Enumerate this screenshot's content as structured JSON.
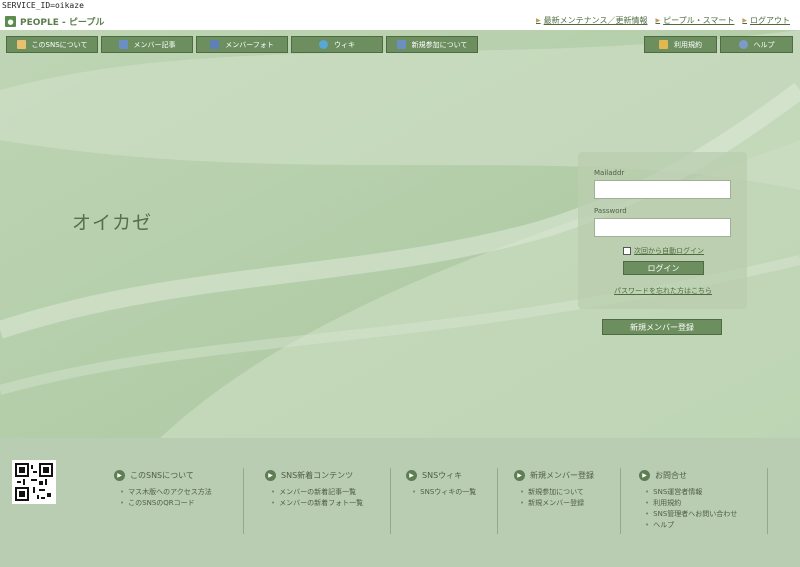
{
  "service_id": "SERVICE_ID=oikaze",
  "logo": {
    "text": "PEOPLE - ピープル"
  },
  "top_links": [
    "最新メンテナンス／更新情報",
    "ピープル・スマート",
    "ログアウト"
  ],
  "nav": {
    "left": [
      {
        "label": "このSNSについて",
        "icon": "people-icon",
        "color": "#e8c170"
      },
      {
        "label": "メンバー記事",
        "icon": "document-icon",
        "color": "#6a8fc4"
      },
      {
        "label": "メンバーフォト",
        "icon": "photo-icon",
        "color": "#5f7fb8"
      },
      {
        "label": "ウィキ",
        "icon": "globe-icon",
        "color": "#58a7d6"
      },
      {
        "label": "新規参加について",
        "icon": "add-user-icon",
        "color": "#6b8fc0"
      }
    ],
    "right": [
      {
        "label": "利用規約",
        "icon": "pencil-icon",
        "color": "#e0b84f"
      },
      {
        "label": "ヘルプ",
        "icon": "help-icon",
        "color": "#7e9ac8"
      }
    ]
  },
  "site_title": "オイカゼ",
  "login": {
    "mail_label": "Mailaddr",
    "password_label": "Password",
    "auto_login": "次回から自動ログイン",
    "button": "ログイン",
    "forgot": "パスワードを忘れた方はこちら"
  },
  "register_button": "新規メンバー登録",
  "footer": {
    "columns": [
      {
        "title": "このSNSについて",
        "items": [
          "マス木版へのアクセス方法",
          "このSNSのQRコード"
        ]
      },
      {
        "title": "SNS新着コンテンツ",
        "items": [
          "メンバーの新着記事一覧",
          "メンバーの新着フォト一覧"
        ]
      },
      {
        "title": "SNSウィキ",
        "items": [
          "SNSウィキの一覧"
        ]
      },
      {
        "title": "新規メンバー登録",
        "items": [
          "新規参加について",
          "新規メンバー登録"
        ]
      },
      {
        "title": "お問合せ",
        "items": [
          "SNS運営者情報",
          "利用規約",
          "SNS管理者へお問い合わせ",
          "ヘルプ"
        ]
      }
    ]
  },
  "colors": {
    "accent": "#6d8f60",
    "hero_bg": "#c2d7b8",
    "footer_bg": "#b8cdb1"
  }
}
